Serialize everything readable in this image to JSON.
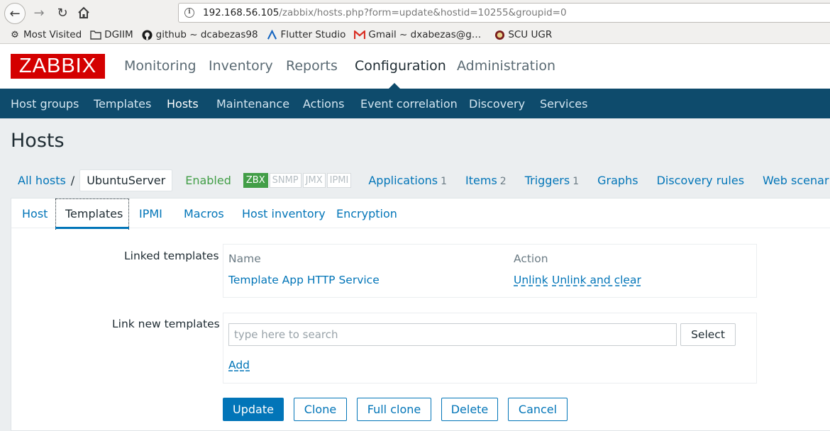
{
  "browser": {
    "url_host": "192.168.56.105",
    "url_path": "/zabbix/hosts.php?form=update&hostid=10255&groupid=0",
    "bookmarks": [
      {
        "label": "Most Visited",
        "icon": "gear-icon"
      },
      {
        "label": "DGIIM",
        "icon": "folder-icon"
      },
      {
        "label": "github ~ dcabezas98",
        "icon": "github-icon"
      },
      {
        "label": "Flutter Studio",
        "icon": "flutter-icon"
      },
      {
        "label": "Gmail ~ dxabezas@g…",
        "icon": "gmail-icon"
      },
      {
        "label": "SCU UGR",
        "icon": "ugr-icon"
      }
    ]
  },
  "header": {
    "logo": "ZABBIX",
    "main_menu": [
      "Monitoring",
      "Inventory",
      "Reports",
      "Configuration",
      "Administration"
    ],
    "active_main": "Configuration",
    "sub_menu": [
      "Host groups",
      "Templates",
      "Hosts",
      "Maintenance",
      "Actions",
      "Event correlation",
      "Discovery",
      "Services"
    ],
    "active_sub": "Hosts"
  },
  "page": {
    "title": "Hosts",
    "host_nav": {
      "all_hosts": "All hosts",
      "separator": "/",
      "current_host": "UbuntuServer",
      "status": "Enabled",
      "interfaces": [
        {
          "label": "ZBX",
          "active": true
        },
        {
          "label": "SNMP",
          "active": false
        },
        {
          "label": "JMX",
          "active": false
        },
        {
          "label": "IPMI",
          "active": false
        }
      ],
      "applications": {
        "label": "Applications",
        "count": "1"
      },
      "items": {
        "label": "Items",
        "count": "2"
      },
      "triggers": {
        "label": "Triggers",
        "count": "1"
      },
      "graphs": "Graphs",
      "discovery_rules": "Discovery rules",
      "web_scenarios": "Web scenarios"
    },
    "tabs": [
      "Host",
      "Templates",
      "IPMI",
      "Macros",
      "Host inventory",
      "Encryption"
    ],
    "active_tab": "Templates",
    "form": {
      "linked_templates_label": "Linked templates",
      "table_headers": {
        "name": "Name",
        "action": "Action"
      },
      "linked_templates": [
        {
          "name": "Template App HTTP Service",
          "unlink": "Unlink",
          "unlink_clear": "Unlink and clear"
        }
      ],
      "link_new_label": "Link new templates",
      "search_placeholder": "type here to search",
      "search_value": "",
      "select_label": "Select",
      "add_label": "Add"
    },
    "buttons": {
      "update": "Update",
      "clone": "Clone",
      "full_clone": "Full clone",
      "delete": "Delete",
      "cancel": "Cancel"
    }
  },
  "colors": {
    "brand_red": "#d40000",
    "nav_dark": "#0e4b6c",
    "link_blue": "#0275b8",
    "enabled_green": "#429e47"
  }
}
